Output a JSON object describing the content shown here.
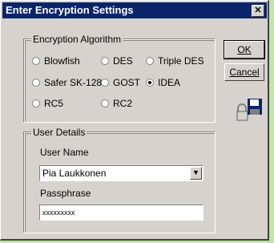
{
  "window": {
    "title": "Enter Encryption Settings",
    "close_glyph": "✕"
  },
  "algorithm": {
    "group_label": "Encryption Algorithm",
    "options": [
      {
        "label": "Blowfish",
        "checked": false
      },
      {
        "label": "DES",
        "checked": false
      },
      {
        "label": "Triple DES",
        "checked": false
      },
      {
        "label": "Safer SK-128",
        "checked": false
      },
      {
        "label": "GOST",
        "checked": false
      },
      {
        "label": "IDEA",
        "checked": true
      },
      {
        "label": "RC5",
        "checked": false
      },
      {
        "label": "RC2",
        "checked": false
      }
    ]
  },
  "buttons": {
    "ok_label": "OK",
    "cancel_label": "Cancel"
  },
  "user": {
    "group_label": "User Details",
    "name_label": "User Name",
    "name_value": "Pia Laukkonen",
    "pass_label": "Passphrase",
    "pass_value": "xxxxxxxxx"
  },
  "icons": {
    "lock_save": "lock-save-icon"
  },
  "colors": {
    "titlebar": "#0a246a",
    "dialog": "#d6d3ce",
    "background": "#c2e6a4"
  }
}
